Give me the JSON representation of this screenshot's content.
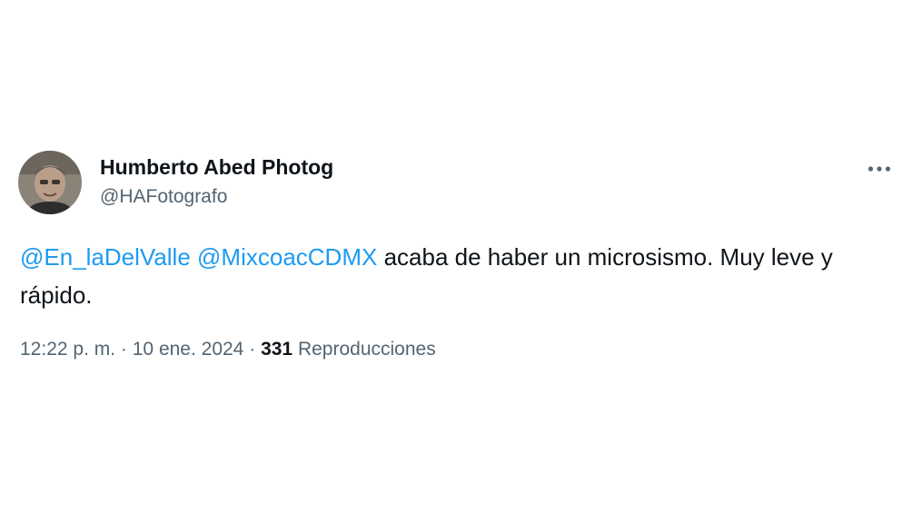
{
  "author": {
    "display_name": "Humberto Abed Photog",
    "handle": "@HAFotografo"
  },
  "tweet": {
    "mentions": [
      "@En_laDelValle",
      "@MixcoacCDMX"
    ],
    "text": "acaba de haber un microsismo. Muy leve y rápido."
  },
  "meta": {
    "time": "12:22 p. m.",
    "separator": "·",
    "date": "10 ene. 2024",
    "views_count": "331",
    "views_label": "Reproducciones"
  },
  "icons": {
    "more": "more-horizontal-icon"
  },
  "colors": {
    "text_primary": "#0f1419",
    "text_secondary": "#536471",
    "link": "#1d9bf0",
    "background": "#ffffff"
  }
}
